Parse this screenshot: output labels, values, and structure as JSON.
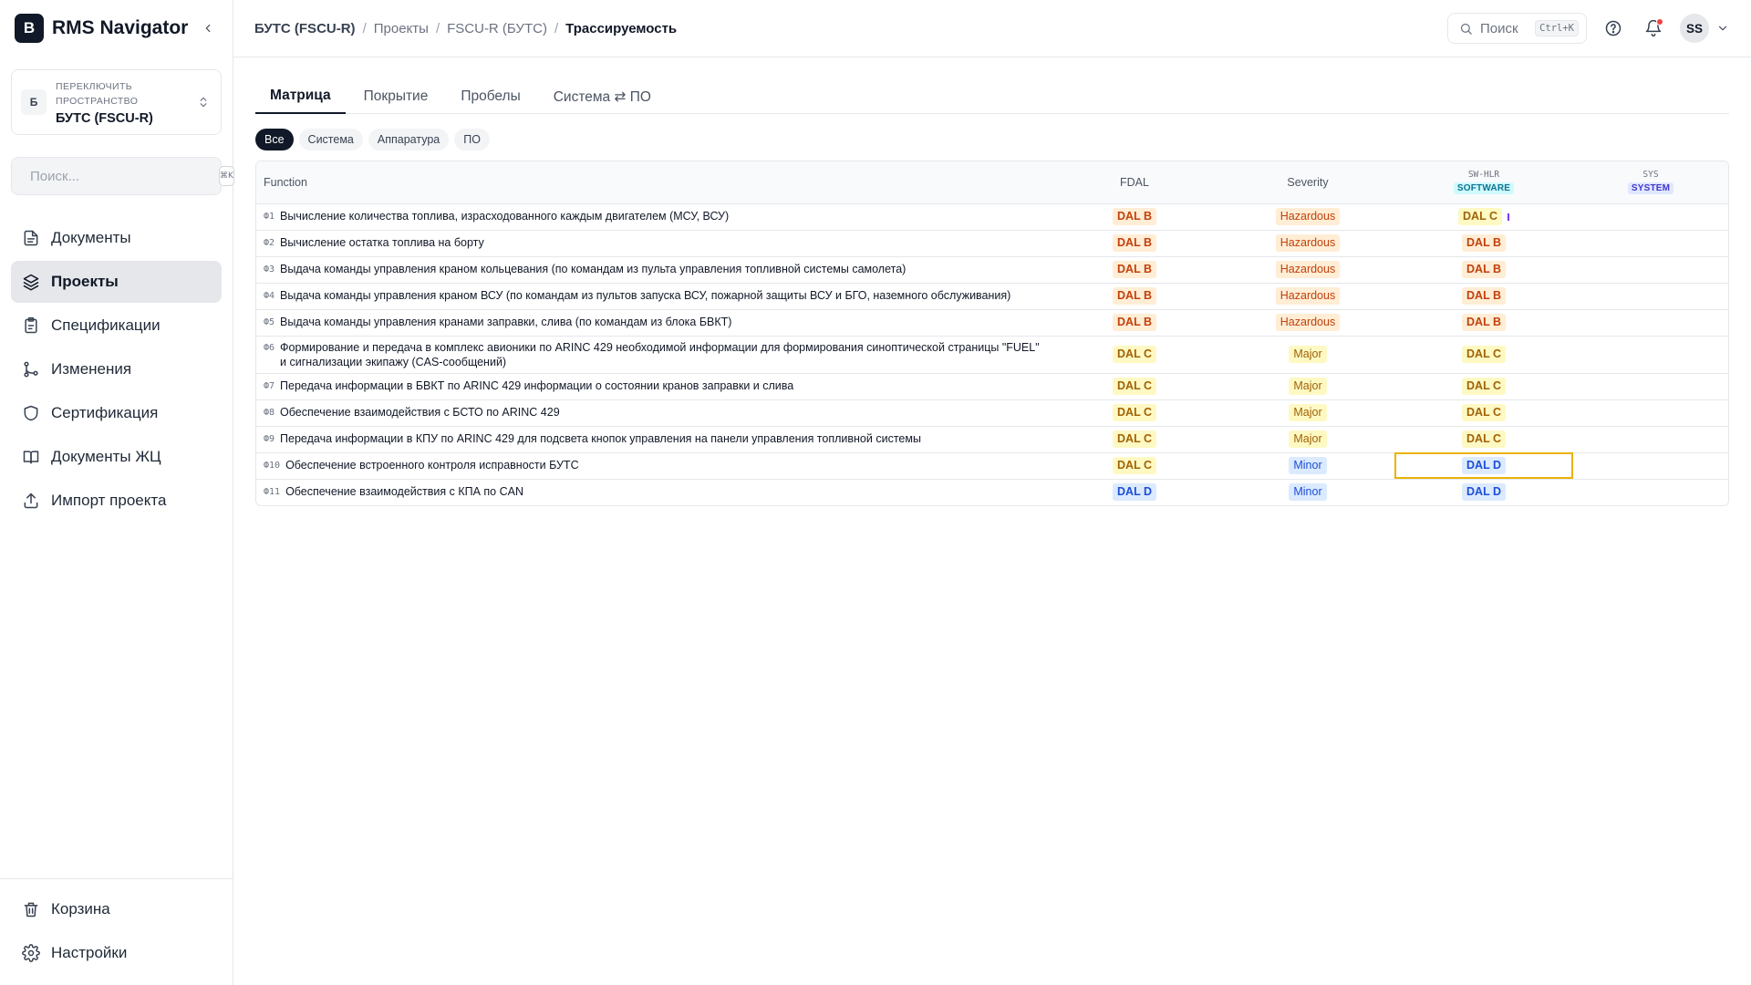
{
  "app": {
    "logo_letter": "B",
    "name": "RMS Navigator"
  },
  "space": {
    "caption": "ПЕРЕКЛЮЧИТЬ ПРОСТРАНСТВО",
    "initial": "Б",
    "name": "БУТС (FSCU-R)"
  },
  "sidebar": {
    "search_placeholder": "Поиск...",
    "search_shortcut": "⌘K",
    "items": [
      {
        "label": "Документы",
        "icon": "document-icon"
      },
      {
        "label": "Проекты",
        "icon": "layers-icon"
      },
      {
        "label": "Спецификации",
        "icon": "clipboard-icon"
      },
      {
        "label": "Изменения",
        "icon": "git-branch-icon"
      },
      {
        "label": "Сертификация",
        "icon": "shield-icon"
      },
      {
        "label": "Документы ЖЦ",
        "icon": "book-icon"
      },
      {
        "label": "Импорт проекта",
        "icon": "upload-icon"
      }
    ],
    "active_index": 1,
    "bottom_items": [
      {
        "label": "Корзина",
        "icon": "trash-icon"
      },
      {
        "label": "Настройки",
        "icon": "gear-icon"
      }
    ]
  },
  "breadcrumb": [
    "БУТС (FSCU-R)",
    "Проекты",
    "FSCU-R (БУТС)",
    "Трассируемость"
  ],
  "topbar": {
    "search_label": "Поиск",
    "search_shortcut": "Ctrl+K",
    "user_initials": "SS"
  },
  "tabs": [
    "Матрица",
    "Покрытие",
    "Пробелы",
    "Система ⇄ ПО"
  ],
  "active_tab": 0,
  "filters": [
    "Все",
    "Система",
    "Аппаратура",
    "ПО"
  ],
  "active_filter": 0,
  "matrix": {
    "headers": {
      "function": "Function",
      "fdal": "FDAL",
      "severity": "Severity",
      "col3_code": "SW-HLR",
      "col3_badge": "SOFTWARE",
      "col4_code": "SYS",
      "col4_badge": "SYSTEM"
    },
    "rows": [
      {
        "code": "Ф1",
        "name": "Вычисление количества топлива, израсходованного каждым двигателем (МСУ, ВСУ)",
        "fdal": "DAL B",
        "severity": "Hazardous",
        "swhlr": "DAL C"
      },
      {
        "code": "Ф2",
        "name": "Вычисление остатка топлива на борту",
        "fdal": "DAL B",
        "severity": "Hazardous",
        "swhlr": "DAL B"
      },
      {
        "code": "Ф3",
        "name": "Выдача команды управления краном кольцевания (по командам из пульта управления топливной системы самолета)",
        "fdal": "DAL B",
        "severity": "Hazardous",
        "swhlr": "DAL B"
      },
      {
        "code": "Ф4",
        "name": "Выдача команды управления краном ВСУ (по командам из пультов запуска ВСУ, пожарной защиты ВСУ и БГО, наземного обслуживания)",
        "fdal": "DAL B",
        "severity": "Hazardous",
        "swhlr": "DAL B"
      },
      {
        "code": "Ф5",
        "name": "Выдача команды управления кранами заправки, слива (по командам из блока БВКТ)",
        "fdal": "DAL B",
        "severity": "Hazardous",
        "swhlr": "DAL B"
      },
      {
        "code": "Ф6",
        "name": "Формирование и передача в комплекс авионики по ARINC 429 необходимой информации для формирования синоптической страницы \"FUEL\" и сигнализации экипажу (CAS-сообщений)",
        "fdal": "DAL C",
        "severity": "Major",
        "swhlr": "DAL C"
      },
      {
        "code": "Ф7",
        "name": "Передача информации в БВКТ по ARINC 429 информации о состоянии кранов заправки и слива",
        "fdal": "DAL C",
        "severity": "Major",
        "swhlr": "DAL C"
      },
      {
        "code": "Ф8",
        "name": "Обеспечение взаимодействия с БСТО по ARINC 429",
        "fdal": "DAL C",
        "severity": "Major",
        "swhlr": "DAL C"
      },
      {
        "code": "Ф9",
        "name": "Передача информации в КПУ по ARINC 429 для подсвета кнопок управления на панели управления топливной системы",
        "fdal": "DAL C",
        "severity": "Major",
        "swhlr": "DAL C"
      },
      {
        "code": "Ф10",
        "name": "Обеспечение встроенного контроля исправности БУТС",
        "fdal": "DAL C",
        "severity": "Minor",
        "swhlr": "DAL D"
      },
      {
        "code": "Ф11",
        "name": "Обеспечение взаимодействия с КПА по CAN",
        "fdal": "DAL D",
        "severity": "Minor",
        "swhlr": "DAL D"
      }
    ],
    "selected_row": 9
  },
  "colors": {
    "accent": "#111827",
    "dal_b": "#c2410c",
    "dal_c": "#a16207",
    "dal_d": "#1d4ed8",
    "software_badge_bg": "#cffafe",
    "system_badge_bg": "#e0e7ff",
    "selection": "#eab308"
  }
}
